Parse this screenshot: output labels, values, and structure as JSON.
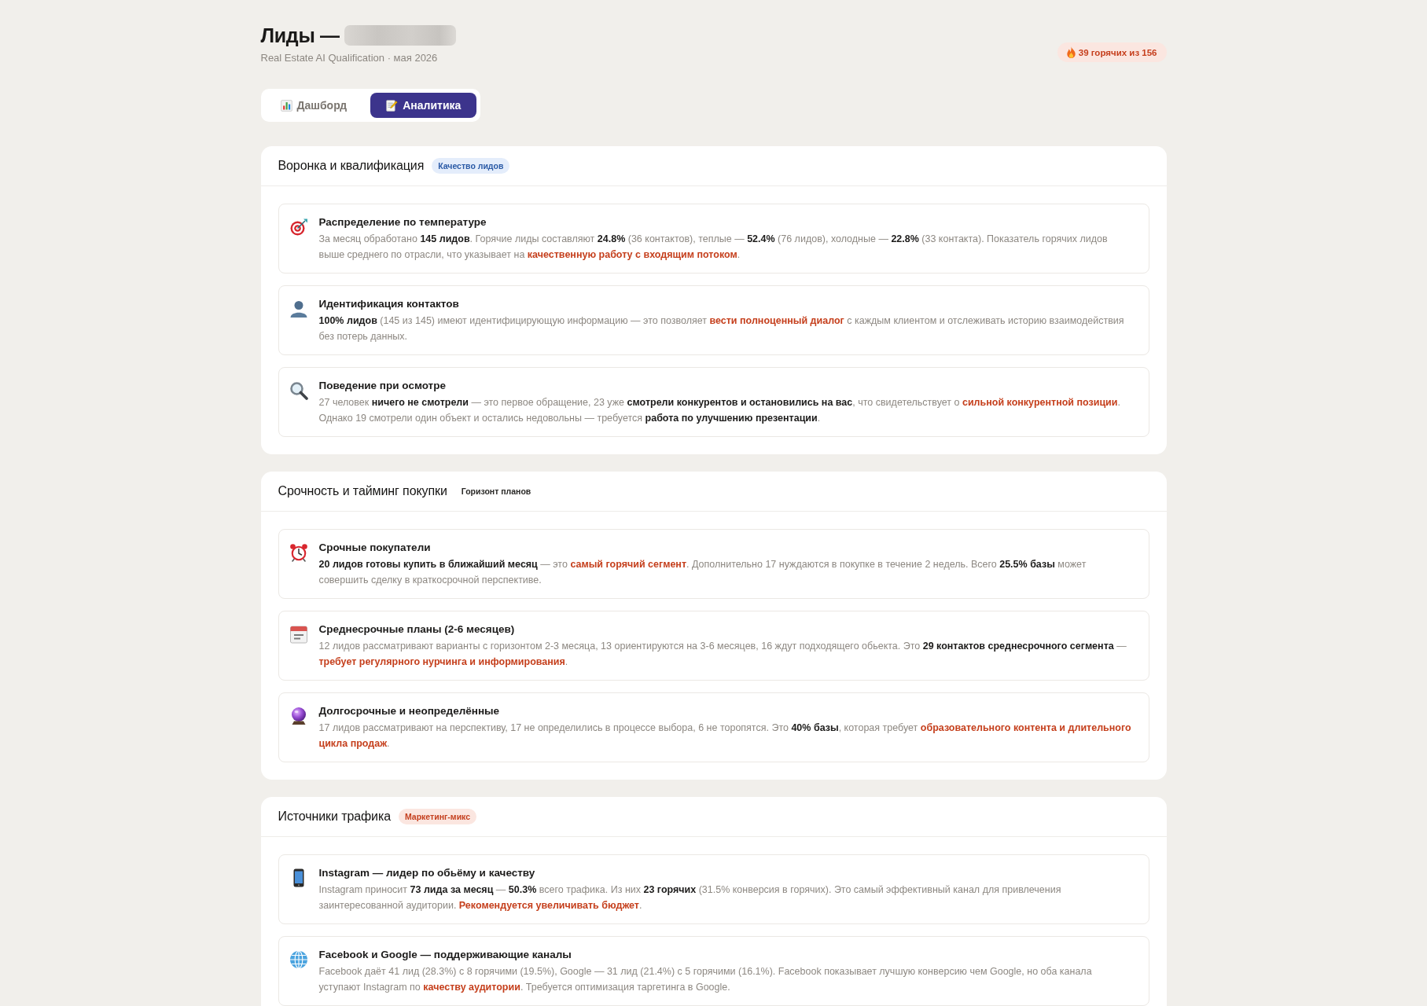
{
  "header": {
    "title": "Лиды —",
    "subtitle": "Real Estate AI Qualification · мая 2026",
    "hot_badge": "39 горячих из 156"
  },
  "tabs": [
    {
      "label": "Дашборд",
      "selected": false
    },
    {
      "label": "Аналитика",
      "selected": true
    }
  ],
  "sections": [
    {
      "title": "Воронка и квалификация",
      "tag": {
        "text": "Качество лидов",
        "kind": "info"
      },
      "cards": [
        {
          "title": "Распределение по температуре",
          "body": [
            {
              "text": "За месяц обработано ",
              "kind": "text"
            },
            {
              "text": "145 лидов",
              "kind": "bold"
            },
            {
              "text": ". Горячие лиды составляют ",
              "kind": "text"
            },
            {
              "text": "24.8%",
              "kind": "bold"
            },
            {
              "text": " (36 контактов), теплые — ",
              "kind": "text"
            },
            {
              "text": "52.4%",
              "kind": "bold"
            },
            {
              "text": " (76 лидов), холодные — ",
              "kind": "text"
            },
            {
              "text": "22.8%",
              "kind": "bold"
            },
            {
              "text": " (33 контакта). Показатель горячих лидов выше среднего по отрасли, что указывает на ",
              "kind": "text"
            },
            {
              "text": "качественную работу с входящим потоком",
              "kind": "accent"
            },
            {
              "text": ".",
              "kind": "text"
            }
          ]
        },
        {
          "title": "Идентификация контактов",
          "body": [
            {
              "text": "100% лидов",
              "kind": "bold"
            },
            {
              "text": " (145 из 145) имеют идентифицирующую информацию — это позволяет ",
              "kind": "text"
            },
            {
              "text": "вести полноценный диалог",
              "kind": "accent"
            },
            {
              "text": " с каждым клиентом и отслеживать историю взаимодействия без потерь данных.",
              "kind": "text"
            }
          ]
        },
        {
          "title": "Поведение при осмотре",
          "body": [
            {
              "text": "27 человек ",
              "kind": "text"
            },
            {
              "text": "ничего не смотрели",
              "kind": "bold"
            },
            {
              "text": " — это первое обращение, 23 уже ",
              "kind": "text"
            },
            {
              "text": "смотрели конкурентов и остановились на вас",
              "kind": "bold"
            },
            {
              "text": ", что свидетельствует о ",
              "kind": "text"
            },
            {
              "text": "сильной конкурентной позиции",
              "kind": "accent"
            },
            {
              "text": ". Однако 19 смотрели один объект и остались недовольны — требуется ",
              "kind": "text"
            },
            {
              "text": "работа по улучшению презентации",
              "kind": "bold"
            },
            {
              "text": ".",
              "kind": "text"
            }
          ]
        }
      ]
    },
    {
      "title": "Срочность и тайминг покупки",
      "tag": {
        "text": "Горизонт планов",
        "kind": "neutral"
      },
      "cards": [
        {
          "title": "Срочные покупатели",
          "body": [
            {
              "text": "20 лидов готовы купить в ближайший месяц",
              "kind": "bold"
            },
            {
              "text": " — это ",
              "kind": "text"
            },
            {
              "text": "самый горячий сегмент",
              "kind": "accent"
            },
            {
              "text": ". Дополнительно 17 нуждаются в покупке в течение 2 недель. Всего ",
              "kind": "text"
            },
            {
              "text": "25.5% базы",
              "kind": "bold"
            },
            {
              "text": " может совершить сделку в краткосрочной перспективе.",
              "kind": "text"
            }
          ]
        },
        {
          "title": "Среднесрочные планы (2-6 месяцев)",
          "body": [
            {
              "text": "12 лидов рассматривают варианты с горизонтом 2-3 месяца, 13 ориентируются на 3-6 месяцев, 16 ждут подходящего обьекта. Это ",
              "kind": "text"
            },
            {
              "text": "29 контактов среднесрочного сегмента",
              "kind": "bold"
            },
            {
              "text": " — ",
              "kind": "text"
            },
            {
              "text": "требует регулярного нурчинга и информирования",
              "kind": "accent"
            },
            {
              "text": ".",
              "kind": "text"
            }
          ]
        },
        {
          "title": "Долгосрочные и неопределённые",
          "body": [
            {
              "text": "17 лидов рассматривают на перспективу, 17 не определились в процессе выбора, 6 не торопятся. Это ",
              "kind": "text"
            },
            {
              "text": "40% базы",
              "kind": "bold"
            },
            {
              "text": ", которая требует ",
              "kind": "text"
            },
            {
              "text": "образовательного контента и длительного цикла продаж",
              "kind": "accent"
            },
            {
              "text": ".",
              "kind": "text"
            }
          ]
        }
      ]
    },
    {
      "title": "Источники трафика",
      "tag": {
        "text": "Маркетинг-микс",
        "kind": "warning"
      },
      "cards": [
        {
          "title": "Instagram — лидер по обьёму и качеству",
          "body": [
            {
              "text": "Instagram приносит ",
              "kind": "text"
            },
            {
              "text": "73 лида за месяц",
              "kind": "bold"
            },
            {
              "text": " — ",
              "kind": "text"
            },
            {
              "text": "50.3%",
              "kind": "bold"
            },
            {
              "text": " всего трафика. Из них ",
              "kind": "text"
            },
            {
              "text": "23 горячих",
              "kind": "bold"
            },
            {
              "text": " (31.5% конверсия в горячих). Это самый эффективный канал для привлечения заинтересованной аудитории. ",
              "kind": "text"
            },
            {
              "text": "Рекомендуется увеличивать бюджет",
              "kind": "accent"
            },
            {
              "text": ".",
              "kind": "text"
            }
          ]
        },
        {
          "title": "Facebook и Google — поддерживающие каналы",
          "body": [
            {
              "text": "Facebook даёт 41 лид (28.3%) с 8 горячими (19.5%), Google — 31 лид (21.4%) с 5 горячими (16.1%). Facebook показывает лучшую конверсию чем Google, но оба канала уступают Instagram по ",
              "kind": "text"
            },
            {
              "text": "качеству аудитории",
              "kind": "accent"
            },
            {
              "text": ". Требуется оптимизация таргетинга в Google.",
              "kind": "text"
            }
          ]
        }
      ]
    }
  ]
}
